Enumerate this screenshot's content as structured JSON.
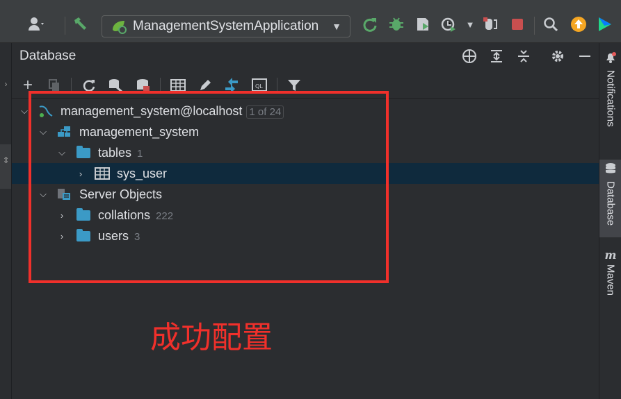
{
  "toolbar": {
    "run_config_label": "ManagementSystemApplication"
  },
  "panel": {
    "title": "Database"
  },
  "tree": {
    "datasource": {
      "label": "management_system@localhost",
      "badge": "1 of 24"
    },
    "schema": {
      "label": "management_system"
    },
    "tables": {
      "label": "tables",
      "count": "1"
    },
    "sys_user": {
      "label": "sys_user"
    },
    "server_objects": {
      "label": "Server Objects"
    },
    "collations": {
      "label": "collations",
      "count": "222"
    },
    "users": {
      "label": "users",
      "count": "3"
    }
  },
  "annotation": {
    "text": "成功配置"
  },
  "right_stripe": {
    "notifications": "Notifications",
    "database": "Database",
    "maven": "Maven"
  },
  "colors": {
    "accent_green": "#4caf50",
    "stop_red": "#c94f4f",
    "update_orange": "#f5a623",
    "folder_blue": "#3b9ac6",
    "selection": "#0f2a3d",
    "annotation_red": "#f0302b"
  }
}
